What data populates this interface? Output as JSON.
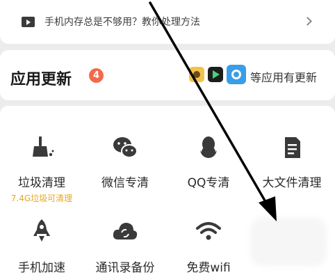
{
  "tip_bar": {
    "text": "手机内存总是不够用？教你处理方法",
    "icon": "play-video-icon",
    "chevron_icon": "chevron-right-icon"
  },
  "app_update": {
    "title": "应用更新",
    "badge_count": "4",
    "apps": [
      "app-icon-1",
      "app-icon-2",
      "app-icon-3"
    ],
    "trailing_text": "等应用有更新"
  },
  "tools": [
    {
      "label": "垃圾清理",
      "sub": "7.4G垃圾可清理",
      "icon": "broom-clean-icon"
    },
    {
      "label": "微信专清",
      "icon": "wechat-icon"
    },
    {
      "label": "QQ专清",
      "icon": "qq-penguin-icon"
    },
    {
      "label": "大文件清理",
      "icon": "document-icon"
    },
    {
      "label": "手机加速",
      "icon": "rocket-icon"
    },
    {
      "label": "通讯录备份",
      "icon": "cloud-sync-icon"
    },
    {
      "label": "免费wifi",
      "icon": "wifi-icon"
    }
  ],
  "colors": {
    "badge": "#f26a4d",
    "sub_text": "#e8a71f",
    "icon": "#3a3a3a",
    "background": "#ececec"
  }
}
